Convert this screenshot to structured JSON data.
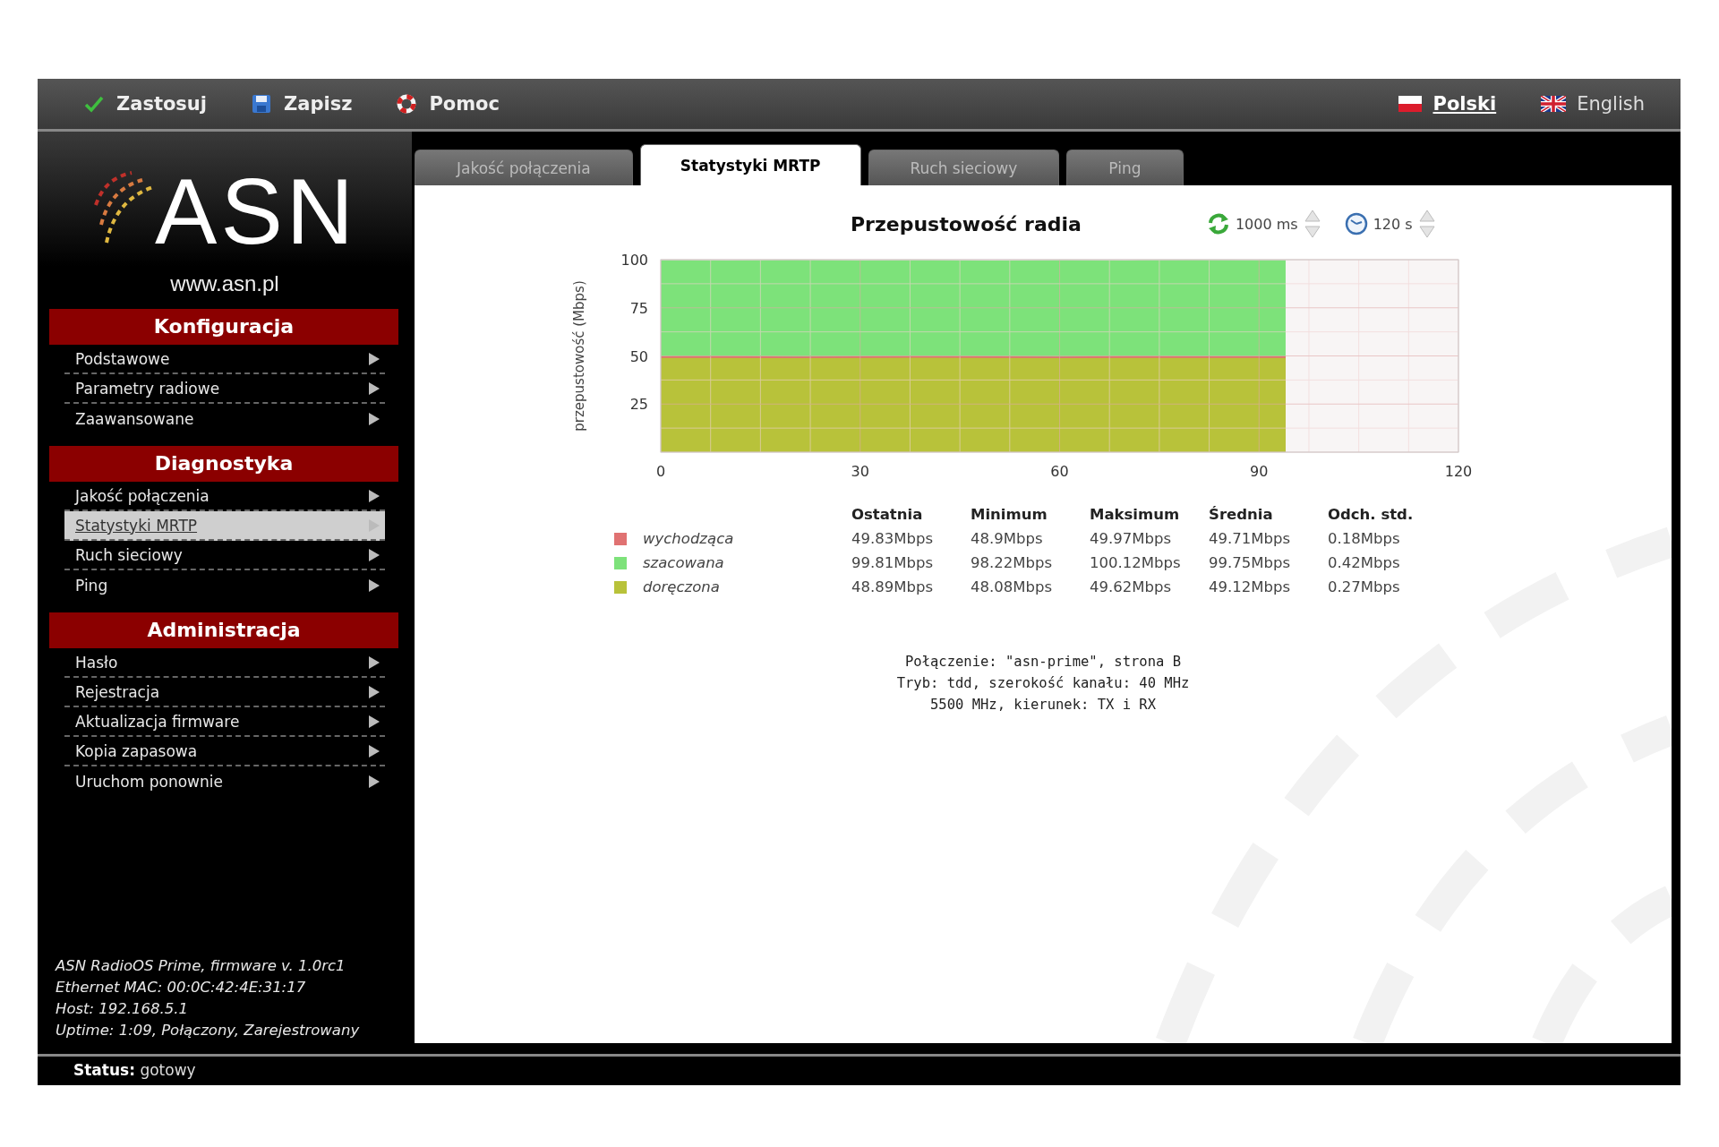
{
  "toolbar": {
    "actions": [
      {
        "kind": "apply",
        "label": "Zastosuj"
      },
      {
        "kind": "save",
        "label": "Zapisz"
      },
      {
        "kind": "help",
        "label": "Pomoc"
      }
    ],
    "languages": [
      {
        "kind": "pl",
        "label": "Polski",
        "selected": true
      },
      {
        "kind": "en",
        "label": "English",
        "selected": false
      }
    ]
  },
  "sidebar": {
    "logo": "ASN",
    "url": "www.asn.pl",
    "sections": [
      {
        "title": "Konfiguracja",
        "items": [
          {
            "label": "Podstawowe",
            "selected": false
          },
          {
            "label": "Parametry radiowe",
            "selected": false
          },
          {
            "label": "Zaawansowane",
            "selected": false
          }
        ]
      },
      {
        "title": "Diagnostyka",
        "items": [
          {
            "label": "Jakość połączenia",
            "selected": false
          },
          {
            "label": "Statystyki MRTP",
            "selected": true
          },
          {
            "label": "Ruch sieciowy",
            "selected": false
          },
          {
            "label": "Ping",
            "selected": false
          }
        ]
      },
      {
        "title": "Administracja",
        "items": [
          {
            "label": "Hasło",
            "selected": false
          },
          {
            "label": "Rejestracja",
            "selected": false
          },
          {
            "label": "Aktualizacja firmware",
            "selected": false
          },
          {
            "label": "Kopia zapasowa",
            "selected": false
          },
          {
            "label": "Uruchom ponownie",
            "selected": false
          }
        ]
      }
    ],
    "info": [
      "ASN RadioOS Prime, firmware v. 1.0rc1",
      "Ethernet MAC: 00:0C:42:4E:31:17",
      "Host: 192.168.5.1",
      "Uptime:  1:09, Połączony, Zarejestrowany"
    ]
  },
  "tabs": [
    {
      "label": "Jakość połączenia",
      "selected": false
    },
    {
      "label": "Statystyki MRTP",
      "selected": true
    },
    {
      "label": "Ruch sieciowy",
      "selected": false
    },
    {
      "label": "Ping",
      "selected": false
    }
  ],
  "chart_panel": {
    "refresh": "1000 ms",
    "window": "120 s",
    "chart_data": {
      "type": "area",
      "title": "Przepustowość radia",
      "ylabel": "przepustowość (Mbps)",
      "x": [
        0,
        10,
        20,
        30,
        40,
        50,
        60,
        70,
        80,
        90,
        94
      ],
      "series": [
        {
          "name": "wychodząca",
          "color": "#e07272",
          "values": [
            49.8,
            49.9,
            49.7,
            49.8,
            49.9,
            49.8,
            49.7,
            49.9,
            49.8,
            49.8,
            49.8
          ]
        },
        {
          "name": "szacowana",
          "color": "#7de27a",
          "values": [
            99.8,
            99.6,
            99.9,
            99.7,
            99.8,
            99.5,
            99.8,
            99.7,
            99.9,
            99.8,
            99.8
          ]
        },
        {
          "name": "doręczona",
          "color": "#b8c23a",
          "values": [
            48.9,
            49.0,
            48.8,
            48.9,
            49.1,
            48.9,
            48.8,
            49.0,
            48.9,
            48.9,
            48.9
          ]
        }
      ],
      "xlim": [
        0,
        120
      ],
      "ylim": [
        0,
        100
      ],
      "xticks": [
        0,
        30,
        60,
        90,
        120
      ],
      "yticks": [
        25,
        50,
        75,
        100
      ],
      "grid": true
    },
    "stats": {
      "columns": [
        "Ostatnia",
        "Minimum",
        "Maksimum",
        "Średnia",
        "Odch. std."
      ],
      "rows": [
        {
          "values": [
            "49.83Mbps",
            "48.9Mbps",
            "49.97Mbps",
            "49.71Mbps",
            "0.18Mbps"
          ]
        },
        {
          "values": [
            "99.81Mbps",
            "98.22Mbps",
            "100.12Mbps",
            "99.75Mbps",
            "0.42Mbps"
          ]
        },
        {
          "values": [
            "48.89Mbps",
            "48.08Mbps",
            "49.62Mbps",
            "49.12Mbps",
            "0.27Mbps"
          ]
        }
      ]
    },
    "connection": [
      "Połączenie: \"asn-prime\", strona B",
      "Tryb: tdd, szerokość kanału: 40 MHz",
      "5500 MHz, kierunek: TX i RX"
    ]
  },
  "status_bar": "**Status:** gotowy"
}
